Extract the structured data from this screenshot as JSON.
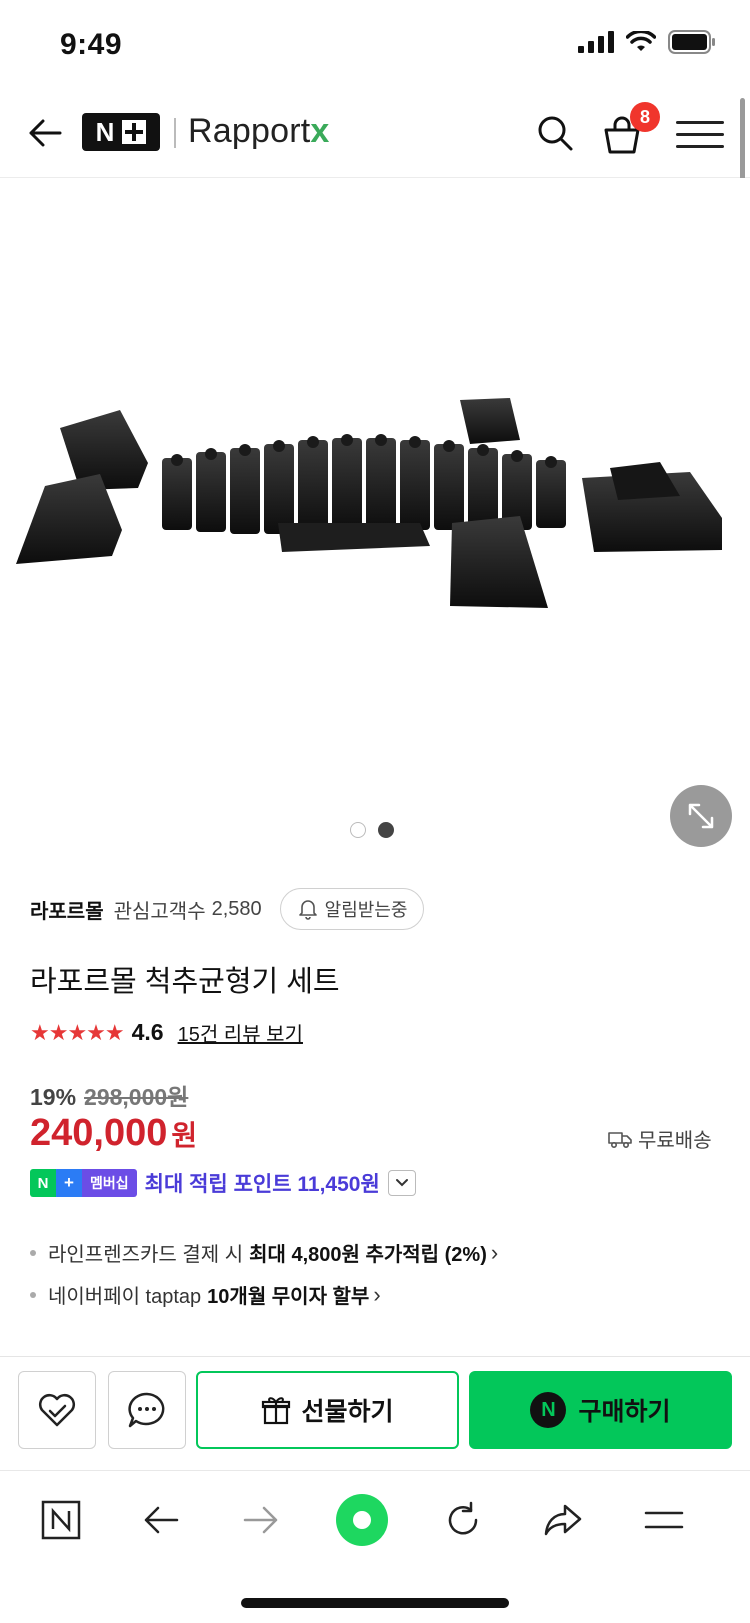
{
  "status_bar": {
    "time": "9:49"
  },
  "header": {
    "logo_badge": "N",
    "brand": {
      "name": "Rapport",
      "suffix": "x"
    },
    "cart_count": "8"
  },
  "gallery": {
    "total_images": 2,
    "active_index": 2
  },
  "seller": {
    "name": "라포르몰",
    "follower_label": "관심고객수",
    "follower_count": "2,580",
    "notify_label": "알림받는중"
  },
  "product": {
    "title": "라포르몰 척추균형기 세트",
    "rating": {
      "stars": 4.6,
      "value": "4.6",
      "reviews_link": "15건 리뷰 보기"
    },
    "discount_rate": "19%",
    "original_price": "298,000원",
    "price": "240,000",
    "price_unit": "원",
    "shipping": "무료배송",
    "membership": {
      "badge_n": "N",
      "badge_plus": "+",
      "badge_label": "멤버십",
      "points_text": "최대 적립 포인트 11,450원"
    },
    "benefits": [
      {
        "prefix": "라인프렌즈카드 결제 시",
        "bold": "최대 4,800원 추가적립 (2%)"
      },
      {
        "prefix": "네이버페이 taptap",
        "bold": "10개월 무이자 할부"
      }
    ]
  },
  "actions": {
    "gift_label": "선물하기",
    "buy_badge": "N",
    "buy_label": "구매하기"
  },
  "colors": {
    "naver_green": "#03c75a",
    "price_red": "#d0232d",
    "points_purple": "#4a3bd8",
    "star_red": "#e63737",
    "badge_red": "#f0352c"
  }
}
